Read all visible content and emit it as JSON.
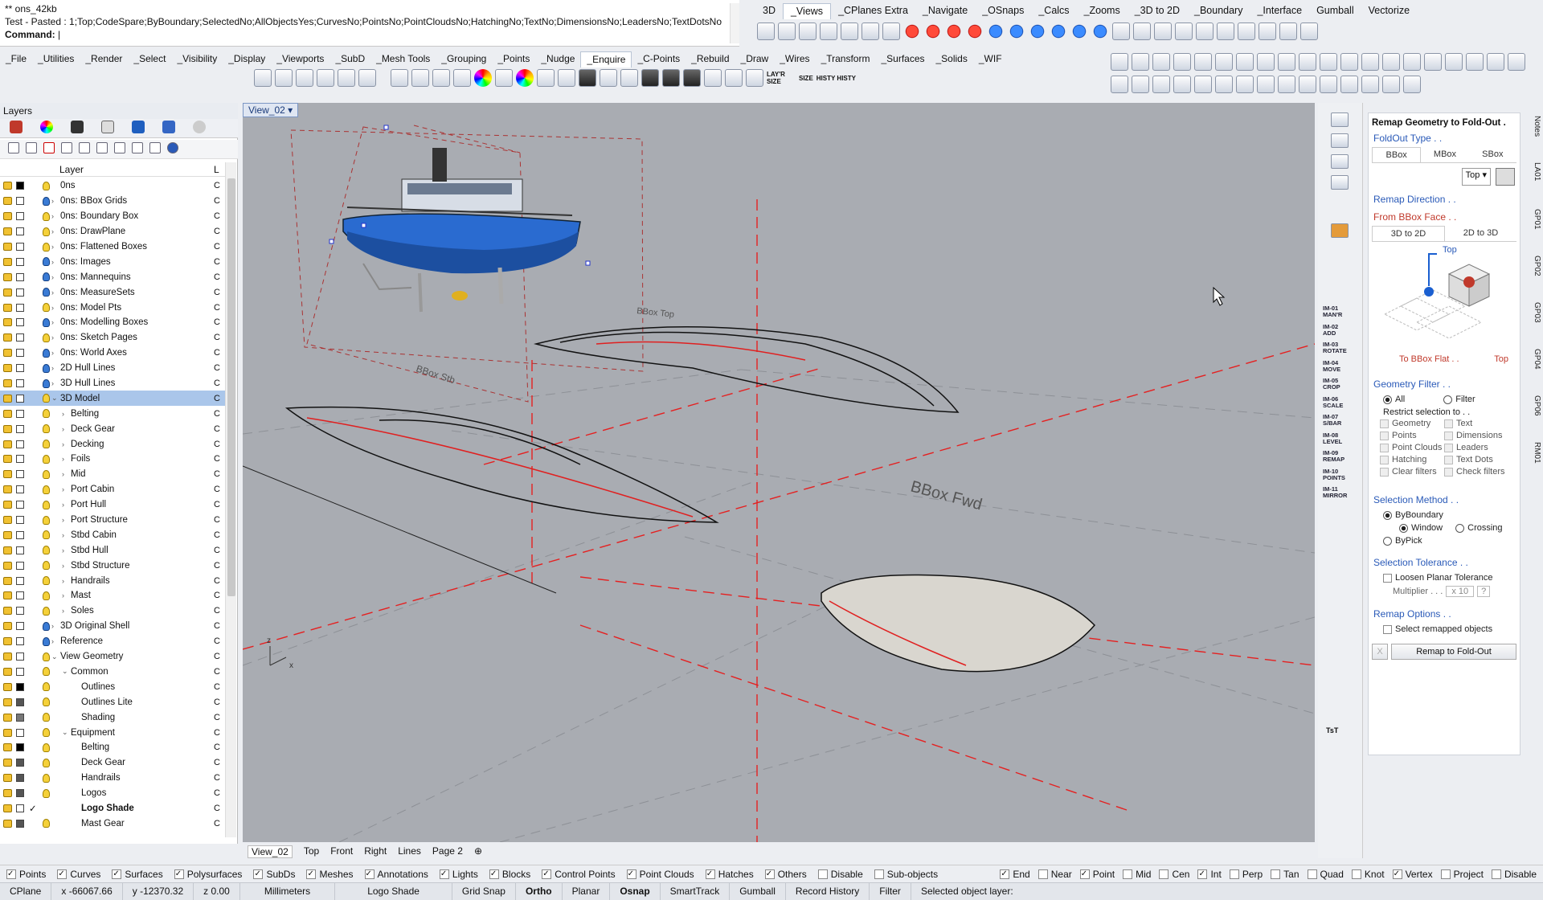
{
  "command": {
    "history_line1": "** ons_42kb",
    "history_line2": "Test - Pasted : 1;Top;CodeSpare;ByBoundary;SelectedNo;AllObjectsYes;CurvesNo;PointsNo;PointCloudsNo;HatchingNo;TextNo;DimensionsNo;LeadersNo;TextDotsNo",
    "prompt": "Command:"
  },
  "top_tabs": [
    "3D",
    "_Views",
    "_CPlanes Extra",
    "_Navigate",
    "_OSnaps",
    "_Calcs",
    "_Zooms",
    "_3D to 2D",
    "_Boundary",
    "_Interface",
    "Gumball",
    "Vectorize"
  ],
  "main_tabs": [
    "_File",
    "_Utilities",
    "_Render",
    "_Select",
    "_Visibility",
    "_Display",
    "_Viewports",
    "_SubD",
    "_Mesh Tools",
    "_Grouping",
    "_Points",
    "_Nudge",
    "_Enquire",
    "_C-Points",
    "_Rebuild",
    "_Draw",
    "_Wires",
    "_Transform",
    "_Surfaces",
    "_Solids",
    "_WIF"
  ],
  "toolbar_text": {
    "layr_size": "LAY'R SIZE",
    "size": "SIZE",
    "histy": "HISTY HISTY"
  },
  "layers": {
    "title": "Layers",
    "column_header": "Layer",
    "column_header2": "L",
    "rows": [
      {
        "name": "0ns",
        "level": 0,
        "bulb": "yellow",
        "swatch": "#000000",
        "c": "C"
      },
      {
        "name": "0ns: BBox Grids",
        "level": 0,
        "bulb": "blue",
        "expander": "›",
        "c": "C"
      },
      {
        "name": "0ns: Boundary Box",
        "level": 0,
        "bulb": "yellow",
        "expander": "›",
        "c": "C"
      },
      {
        "name": "0ns: DrawPlane",
        "level": 0,
        "bulb": "yellow",
        "expander": "›",
        "c": "C"
      },
      {
        "name": "0ns: Flattened Boxes",
        "level": 0,
        "bulb": "yellow",
        "expander": "›",
        "c": "C"
      },
      {
        "name": "0ns: Images",
        "level": 0,
        "bulb": "blue",
        "expander": "›",
        "c": "C"
      },
      {
        "name": "0ns: Mannequins",
        "level": 0,
        "bulb": "blue",
        "expander": "›",
        "c": "C"
      },
      {
        "name": "0ns: MeasureSets",
        "level": 0,
        "bulb": "blue",
        "expander": "›",
        "c": "C"
      },
      {
        "name": "0ns: Model Pts",
        "level": 0,
        "bulb": "yellow",
        "expander": "›",
        "c": "C"
      },
      {
        "name": "0ns: Modelling Boxes",
        "level": 0,
        "bulb": "blue",
        "expander": "›",
        "c": "C"
      },
      {
        "name": "0ns: Sketch Pages",
        "level": 0,
        "bulb": "yellow",
        "expander": "›",
        "c": "C"
      },
      {
        "name": "0ns: World Axes",
        "level": 0,
        "bulb": "blue",
        "expander": "›",
        "c": "C"
      },
      {
        "name": "2D Hull Lines",
        "level": 0,
        "bulb": "blue",
        "expander": "›",
        "c": "C"
      },
      {
        "name": "3D Hull Lines",
        "level": 0,
        "bulb": "blue",
        "expander": "›",
        "c": "C"
      },
      {
        "name": "3D Model",
        "level": 0,
        "bulb": "yellow",
        "expander": "⌄",
        "c": "C",
        "selected": true
      },
      {
        "name": "Belting",
        "level": 1,
        "bulb": "yellow",
        "expander": "›",
        "c": "C"
      },
      {
        "name": "Deck Gear",
        "level": 1,
        "bulb": "yellow",
        "expander": "›",
        "c": "C"
      },
      {
        "name": "Decking",
        "level": 1,
        "bulb": "yellow",
        "expander": "›",
        "c": "C"
      },
      {
        "name": "Foils",
        "level": 1,
        "bulb": "yellow",
        "expander": "›",
        "c": "C"
      },
      {
        "name": "Mid",
        "level": 1,
        "bulb": "yellow",
        "expander": "›",
        "c": "C"
      },
      {
        "name": "Port Cabin",
        "level": 1,
        "bulb": "yellow",
        "expander": "›",
        "c": "C"
      },
      {
        "name": "Port Hull",
        "level": 1,
        "bulb": "yellow",
        "expander": "›",
        "c": "C"
      },
      {
        "name": "Port Structure",
        "level": 1,
        "bulb": "yellow",
        "expander": "›",
        "c": "C"
      },
      {
        "name": "Stbd Cabin",
        "level": 1,
        "bulb": "yellow",
        "expander": "›",
        "c": "C"
      },
      {
        "name": "Stbd Hull",
        "level": 1,
        "bulb": "yellow",
        "expander": "›",
        "c": "C"
      },
      {
        "name": "Stbd Structure",
        "level": 1,
        "bulb": "yellow",
        "expander": "›",
        "c": "C"
      },
      {
        "name": "Handrails",
        "level": 1,
        "bulb": "yellow",
        "expander": "›",
        "c": "C"
      },
      {
        "name": "Mast",
        "level": 1,
        "bulb": "yellow",
        "expander": "›",
        "c": "C"
      },
      {
        "name": "Soles",
        "level": 1,
        "bulb": "yellow",
        "expander": "›",
        "c": "C"
      },
      {
        "name": "3D Original Shell",
        "level": 0,
        "bulb": "blue",
        "expander": "›",
        "c": "C"
      },
      {
        "name": "Reference",
        "level": 0,
        "bulb": "blue",
        "expander": "›",
        "c": "C"
      },
      {
        "name": "View Geometry",
        "level": 0,
        "bulb": "yellow",
        "expander": "⌄",
        "c": "C"
      },
      {
        "name": "Common",
        "level": 1,
        "bulb": "yellow",
        "expander": "⌄",
        "c": "C"
      },
      {
        "name": "Outlines",
        "level": 2,
        "bulb": "yellow",
        "swatch": "#000000",
        "c": "C"
      },
      {
        "name": "Outlines Lite",
        "level": 2,
        "bulb": "yellow",
        "swatch": "#555555",
        "c": "C"
      },
      {
        "name": "Shading",
        "level": 2,
        "bulb": "yellow",
        "swatch": "#777777",
        "c": "C"
      },
      {
        "name": "Equipment",
        "level": 1,
        "bulb": "yellow",
        "expander": "⌄",
        "c": "C"
      },
      {
        "name": "Belting",
        "level": 2,
        "bulb": "yellow",
        "swatch": "#000000",
        "c": "C"
      },
      {
        "name": "Deck Gear",
        "level": 2,
        "bulb": "yellow",
        "swatch": "#555555",
        "c": "C"
      },
      {
        "name": "Handrails",
        "level": 2,
        "bulb": "yellow",
        "swatch": "#555555",
        "c": "C"
      },
      {
        "name": "Logos",
        "level": 2,
        "bulb": "yellow",
        "swatch": "#555555",
        "c": "C"
      },
      {
        "name": "Logo Shade",
        "level": 2,
        "bulb": "none",
        "check": "✓",
        "c": "C",
        "bold": true
      },
      {
        "name": "Mast Gear",
        "level": 2,
        "bulb": "yellow",
        "swatch": "#555555",
        "c": "C"
      }
    ]
  },
  "viewport": {
    "name": "View_02",
    "labels": [
      "BBox Stb",
      "BBox Top",
      "BBox Fwd"
    ],
    "axis_x": "x",
    "axis_z": "z"
  },
  "view_tabs": [
    "View_02",
    "Top",
    "Front",
    "Right",
    "Lines",
    "Page 2"
  ],
  "side_labels": [
    "IM-01 MAN'R",
    "IM-02 ADD",
    "IM-03 ROTATE",
    "IM-04 MOVE",
    "IM-05 CROP",
    "IM-06 SCALE",
    "IM-07 S/BAR",
    "IM-08 LEVEL",
    "IM-09 REMAP",
    "IM-10 POINTS",
    "IM-11 MIRROR"
  ],
  "side_text": {
    "tst": "TsT"
  },
  "remap": {
    "title": "Remap Geometry to Fold-Out .",
    "foldout_type": "FoldOut Type . .",
    "type_tabs": [
      "BBox",
      "MBox",
      "SBox"
    ],
    "view_select": "Top",
    "remap_direction": "Remap Direction . .",
    "from_face": "From BBox Face . .",
    "dir_tabs": [
      "3D to 2D",
      "2D to 3D"
    ],
    "diagram_label": "Top",
    "to_flat": "To BBox Flat . .",
    "to_flat_value": "Top",
    "geometry_filter": "Geometry Filter . .",
    "filter_all": "All",
    "filter_filter": "Filter",
    "restrict": "Restrict selection to . .",
    "filter_items": [
      "Geometry",
      "Text",
      "Points",
      "Dimensions",
      "Point Clouds",
      "Leaders",
      "Hatching",
      "Text Dots",
      "Clear filters",
      "Check filters"
    ],
    "selection_method": "Selection Method . .",
    "by_boundary": "ByBoundary",
    "window": "Window",
    "crossing": "Crossing",
    "by_pick": "ByPick",
    "selection_tolerance": "Selection Tolerance . .",
    "loosen": "Loosen Planar Tolerance",
    "multiplier": "Multiplier . . .",
    "multiplier_value": "x 10",
    "remap_options": "Remap Options . .",
    "select_remapped": "Select remapped objects",
    "remap_button": "Remap to Fold-Out",
    "x_button": "X"
  },
  "right_vtabs": [
    "Notes",
    "LA01",
    "GP01",
    "GP02",
    "GP03",
    "GP04",
    "GP06",
    "RM01"
  ],
  "filters": [
    "Points",
    "Curves",
    "Surfaces",
    "Polysurfaces",
    "SubDs",
    "Meshes",
    "Annotations",
    "Lights",
    "Blocks",
    "Control Points",
    "Point Clouds",
    "Hatches",
    "Others",
    "Disable",
    "Sub-objects"
  ],
  "filters_checked": [
    true,
    true,
    true,
    true,
    true,
    true,
    true,
    true,
    true,
    true,
    true,
    true,
    true,
    false,
    false
  ],
  "osnaps": [
    "End",
    "Near",
    "Point",
    "Mid",
    "Cen",
    "Int",
    "Perp",
    "Tan",
    "Quad",
    "Knot",
    "Vertex",
    "Project",
    "Disable"
  ],
  "osnaps_checked": [
    true,
    false,
    true,
    false,
    false,
    true,
    false,
    false,
    false,
    false,
    true,
    false,
    false
  ],
  "status": {
    "cplane": "CPlane",
    "x": "x -66067.66",
    "y": "y -12370.32",
    "z": "z 0.00",
    "units": "Millimeters",
    "layer": "Logo Shade",
    "grid_snap": "Grid Snap",
    "ortho": "Ortho",
    "planar": "Planar",
    "osnap": "Osnap",
    "smarttrack": "SmartTrack",
    "gumball": "Gumball",
    "record_history": "Record History",
    "filter": "Filter",
    "message": "Selected object layer:"
  },
  "colors": {
    "accent": "#2a5ab8",
    "selection": "#aac6ea",
    "viewport_bg": "#a9acb2"
  }
}
